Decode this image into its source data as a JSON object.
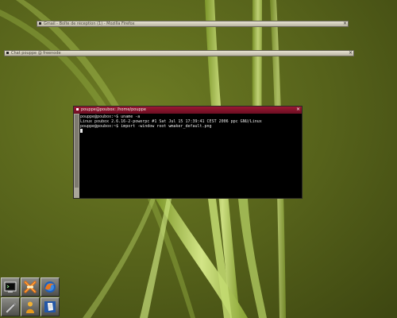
{
  "shaded_windows": [
    {
      "title": "Gmail - Boîte de réception (1) - Mozilla Firefox"
    },
    {
      "title": "Chat pouppe @ freenode"
    }
  ],
  "terminal": {
    "title": "pouppe@poubox: /home/pouppe",
    "lines": [
      "pouppe@poubox:~$ uname -a",
      "Linux poubox 2.6.16-2-powerpc #1 Sat Jul 15 17:39:41 CEST 2006 ppc GNU/Linux",
      "pouppe@poubox:~$ import -window root wmaker_default.png"
    ]
  },
  "dock_icons": [
    {
      "name": "terminal-icon"
    },
    {
      "name": "xchat-icon"
    },
    {
      "name": "firefox-icon"
    },
    {
      "name": "pencil-icon"
    },
    {
      "name": "user-icon"
    },
    {
      "name": "document-icon"
    }
  ],
  "colors": {
    "background": "#4f5b16",
    "grass": "#b7d06a",
    "terminal_titlebar": "#8a1430",
    "terminal_bg": "#000000"
  }
}
